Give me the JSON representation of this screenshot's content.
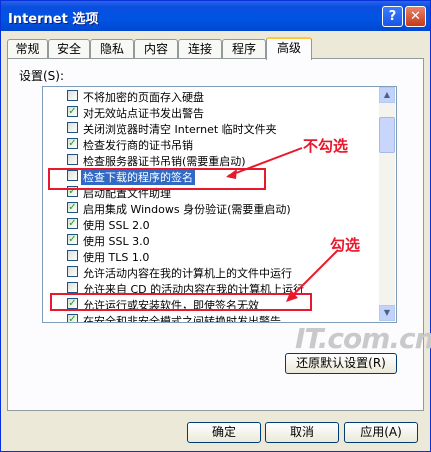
{
  "window": {
    "title": "Internet 选项",
    "help_glyph": "?",
    "close_glyph": "✕"
  },
  "tabs": [
    "常规",
    "安全",
    "隐私",
    "内容",
    "连接",
    "程序",
    "高级"
  ],
  "active_tab": "高级",
  "settings_label": "设置(S):",
  "items": [
    {
      "label": "不将加密的页面存入硬盘",
      "checked": false
    },
    {
      "label": "对无效站点证书发出警告",
      "checked": true
    },
    {
      "label": "关闭浏览器时清空 Internet 临时文件夹",
      "checked": false
    },
    {
      "label": "检查发行商的证书吊销",
      "checked": true
    },
    {
      "label": "检查服务器证书吊销(需要重启动)",
      "checked": false
    },
    {
      "label": "检查下载的程序的签名",
      "checked": false
    },
    {
      "label": "启动配置文件助理",
      "checked": true
    },
    {
      "label": "启用集成 Windows 身份验证(需要重启动)",
      "checked": true
    },
    {
      "label": "使用 SSL 2.0",
      "checked": true
    },
    {
      "label": "使用 SSL 3.0",
      "checked": true
    },
    {
      "label": "使用 TLS 1.0",
      "checked": false
    },
    {
      "label": "允许活动内容在我的计算机上的文件中运行",
      "checked": false
    },
    {
      "label": "允许来自 CD 的活动内容在我的计算机上运行",
      "checked": false
    },
    {
      "label": "允许运行或安装软件，即使签名无效",
      "checked": true
    },
    {
      "label": "在安全和非安全模式之间转换时发出警告",
      "checked": true
    }
  ],
  "restore_button": "还原默认设置(R)",
  "buttons": {
    "ok": "确定",
    "cancel": "取消",
    "apply": "应用(A)"
  },
  "annotations": {
    "uncheck": "不勾选",
    "check": "勾选"
  },
  "watermark": "IT.com.cn",
  "colors": {
    "title_bar": "#0054e3",
    "selection": "#316ac5",
    "annotation": "#e8192c",
    "check": "#21a121"
  },
  "scrollbar_glyphs": {
    "up": "▲",
    "down": "▼"
  }
}
